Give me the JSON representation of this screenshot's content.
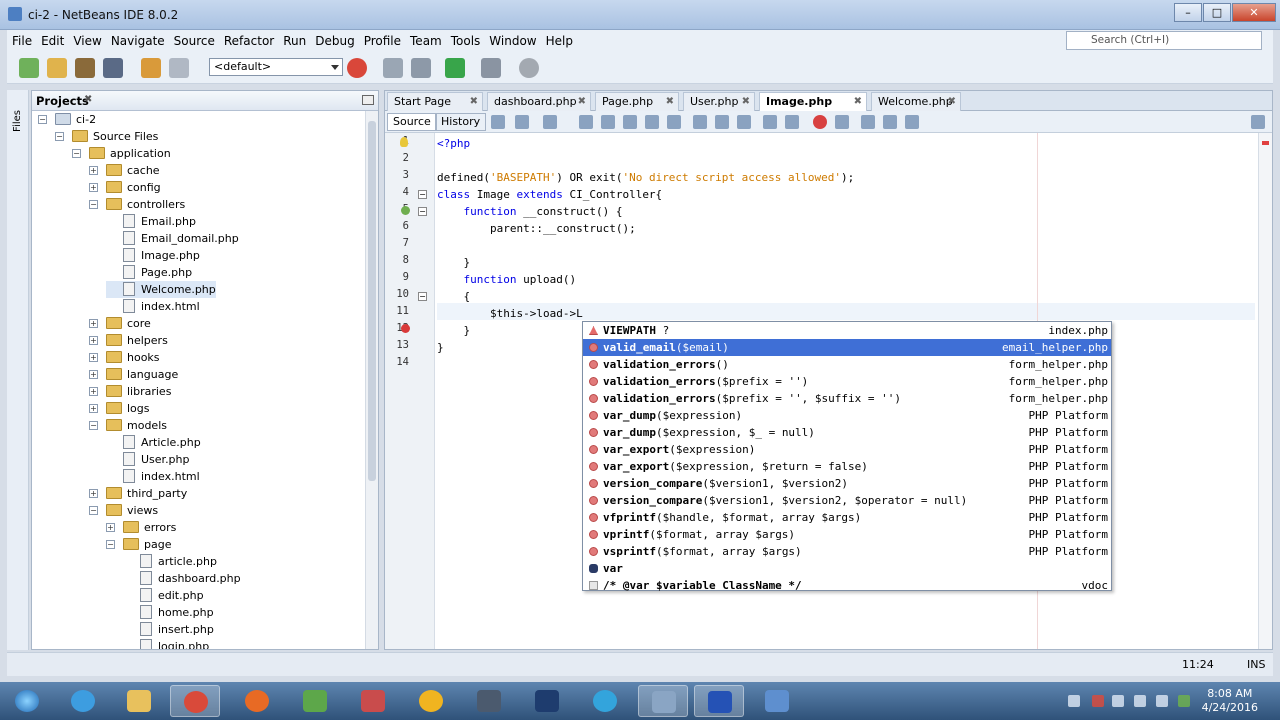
{
  "window": {
    "title": "ci-2 - NetBeans IDE 8.0.2",
    "min": "–",
    "max": "□",
    "close": "✕"
  },
  "menu": [
    "File",
    "Edit",
    "View",
    "Navigate",
    "Source",
    "Refactor",
    "Run",
    "Debug",
    "Profile",
    "Team",
    "Tools",
    "Window",
    "Help"
  ],
  "search": {
    "placeholder": "Search (Ctrl+I)"
  },
  "toolbar": {
    "config": "<default>"
  },
  "side_strip": {
    "label": "Files"
  },
  "projects": {
    "title": "Projects",
    "close": "✖",
    "tree": [
      {
        "label": "ci-2",
        "type": "project",
        "level": 0,
        "expanded": true
      },
      {
        "label": "Source Files",
        "type": "folder",
        "level": 1,
        "expanded": true
      },
      {
        "label": "application",
        "type": "folder",
        "level": 2,
        "expanded": true
      },
      {
        "label": "cache",
        "type": "folder",
        "level": 3,
        "expanded": false
      },
      {
        "label": "config",
        "type": "folder",
        "level": 3,
        "expanded": false
      },
      {
        "label": "controllers",
        "type": "folder",
        "level": 3,
        "expanded": true
      },
      {
        "label": "Email.php",
        "type": "file",
        "level": 4
      },
      {
        "label": "Email_domail.php",
        "type": "file",
        "level": 4
      },
      {
        "label": "Image.php",
        "type": "file",
        "level": 4
      },
      {
        "label": "Page.php",
        "type": "file",
        "level": 4
      },
      {
        "label": "Welcome.php",
        "type": "file",
        "level": 4,
        "selected": true
      },
      {
        "label": "index.html",
        "type": "file",
        "level": 4
      },
      {
        "label": "core",
        "type": "folder",
        "level": 3,
        "expanded": false
      },
      {
        "label": "helpers",
        "type": "folder",
        "level": 3,
        "expanded": false
      },
      {
        "label": "hooks",
        "type": "folder",
        "level": 3,
        "expanded": false
      },
      {
        "label": "language",
        "type": "folder",
        "level": 3,
        "expanded": false
      },
      {
        "label": "libraries",
        "type": "folder",
        "level": 3,
        "expanded": false
      },
      {
        "label": "logs",
        "type": "folder",
        "level": 3,
        "expanded": false
      },
      {
        "label": "models",
        "type": "folder",
        "level": 3,
        "expanded": true
      },
      {
        "label": "Article.php",
        "type": "file",
        "level": 4
      },
      {
        "label": "User.php",
        "type": "file",
        "level": 4
      },
      {
        "label": "index.html",
        "type": "file",
        "level": 4
      },
      {
        "label": "third_party",
        "type": "folder",
        "level": 3,
        "expanded": false
      },
      {
        "label": "views",
        "type": "folder",
        "level": 3,
        "expanded": true
      },
      {
        "label": "errors",
        "type": "folder",
        "level": 4,
        "expanded": false
      },
      {
        "label": "page",
        "type": "folder",
        "level": 4,
        "expanded": true
      },
      {
        "label": "article.php",
        "type": "file",
        "level": 5
      },
      {
        "label": "dashboard.php",
        "type": "file",
        "level": 5
      },
      {
        "label": "edit.php",
        "type": "file",
        "level": 5
      },
      {
        "label": "home.php",
        "type": "file",
        "level": 5
      },
      {
        "label": "insert.php",
        "type": "file",
        "level": 5
      },
      {
        "label": "login.php",
        "type": "file",
        "level": 5
      }
    ]
  },
  "editor": {
    "tabs": [
      {
        "label": "Start Page",
        "active": false
      },
      {
        "label": "dashboard.php",
        "active": false
      },
      {
        "label": "Page.php",
        "active": false
      },
      {
        "label": "User.php",
        "active": false
      },
      {
        "label": "Image.php",
        "active": true
      },
      {
        "label": "Welcome.php",
        "active": false
      }
    ],
    "tab_close": "✖",
    "subtabs": [
      "Source",
      "History"
    ],
    "line_numbers": [
      "1",
      "2",
      "3",
      "4",
      "5",
      "6",
      "7",
      "8",
      "9",
      "10",
      "11",
      "12",
      "13",
      "14"
    ],
    "code": [
      [
        {
          "t": "<?php",
          "c": "kw"
        }
      ],
      [],
      [
        {
          "t": "defined(",
          "c": ""
        },
        {
          "t": "'BASEPATH'",
          "c": "str"
        },
        {
          "t": ") OR exit(",
          "c": ""
        },
        {
          "t": "'No direct script access allowed'",
          "c": "str"
        },
        {
          "t": ");",
          "c": ""
        }
      ],
      [
        {
          "t": "class",
          "c": "kw"
        },
        {
          "t": " Image ",
          "c": ""
        },
        {
          "t": "extends",
          "c": "kw"
        },
        {
          "t": " CI_Controller{",
          "c": ""
        }
      ],
      [
        {
          "t": "    ",
          "c": ""
        },
        {
          "t": "function",
          "c": "kw"
        },
        {
          "t": " __construct",
          "c": ""
        },
        {
          "t": "() {",
          "c": ""
        }
      ],
      [
        {
          "t": "        parent::",
          "c": ""
        },
        {
          "t": "__construct",
          "c": ""
        },
        {
          "t": "();",
          "c": ""
        }
      ],
      [],
      [
        {
          "t": "    }",
          "c": ""
        }
      ],
      [
        {
          "t": "    ",
          "c": ""
        },
        {
          "t": "function",
          "c": "kw"
        },
        {
          "t": " upload()",
          "c": ""
        }
      ],
      [
        {
          "t": "    {",
          "c": ""
        }
      ],
      [
        {
          "t": "        $this->load->L",
          "c": ""
        }
      ],
      [
        {
          "t": "    }",
          "c": ""
        }
      ],
      [
        {
          "t": "}",
          "c": ""
        }
      ],
      []
    ]
  },
  "completion": [
    {
      "name": "VIEWPATH",
      "args": " ?",
      "source": "index.php",
      "icon": "constant"
    },
    {
      "name": "valid_email",
      "args": "($email)",
      "source": "email_helper.php",
      "selected": true
    },
    {
      "name": "validation_errors",
      "args": "()",
      "source": "form_helper.php"
    },
    {
      "name": "validation_errors",
      "args": "($prefix = '')",
      "source": "form_helper.php"
    },
    {
      "name": "validation_errors",
      "args": "($prefix = '', $suffix = '')",
      "source": "form_helper.php"
    },
    {
      "name": "var_dump",
      "args": "($expression)",
      "source": "PHP Platform"
    },
    {
      "name": "var_dump",
      "args": "($expression, $_ = null)",
      "source": "PHP Platform"
    },
    {
      "name": "var_export",
      "args": "($expression)",
      "source": "PHP Platform"
    },
    {
      "name": "var_export",
      "args": "($expression, $return = false)",
      "source": "PHP Platform"
    },
    {
      "name": "version_compare",
      "args": "($version1, $version2)",
      "source": "PHP Platform"
    },
    {
      "name": "version_compare",
      "args": "($version1, $version2, $operator = null)",
      "source": "PHP Platform"
    },
    {
      "name": "vfprintf",
      "args": "($handle, $format, array $args)",
      "source": "PHP Platform"
    },
    {
      "name": "vprintf",
      "args": "($format, array $args)",
      "source": "PHP Platform"
    },
    {
      "name": "vsprintf",
      "args": "($format, array $args)",
      "source": "PHP Platform"
    },
    {
      "name": "var",
      "args": "",
      "source": "",
      "icon": "keyword"
    },
    {
      "name": "/* @var $variable ClassName */",
      "args": "",
      "source": "vdoc",
      "icon": "doc"
    }
  ],
  "status": {
    "position": "11:24",
    "mode": "INS"
  },
  "clock": {
    "time": "8:08 AM",
    "date": "4/24/2016"
  },
  "colors": {
    "selection": "#3f6fd6",
    "keyword": "#0000e6",
    "string": "#ce7b00"
  }
}
